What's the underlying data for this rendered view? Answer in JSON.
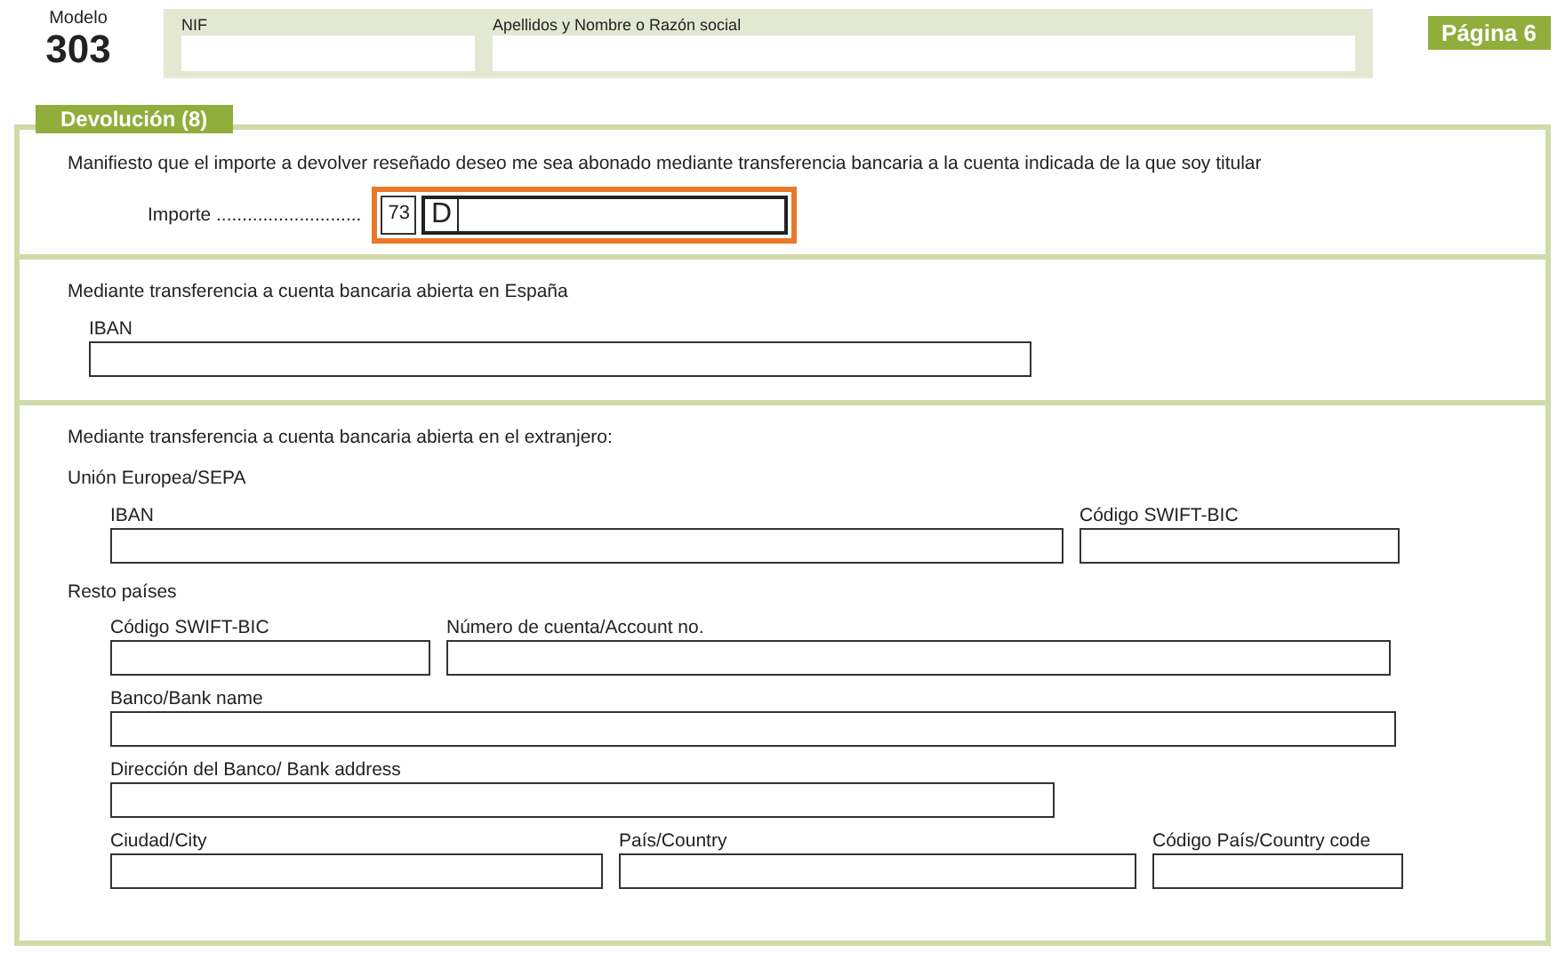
{
  "header": {
    "model_label": "Modelo",
    "model_number": "303",
    "fields": [
      {
        "label": "NIF"
      },
      {
        "label": "Apellidos y Nombre o Razón social"
      }
    ],
    "page_badge": "Página 6"
  },
  "section": {
    "title": "Devolución (8)",
    "statement": "Manifiesto que el importe a devolver reseñado deseo me sea abonado mediante transferencia bancaria a la cuenta indicada de la que soy titular",
    "amount": {
      "label": "Importe ............................",
      "box_number": "73",
      "sign": "D"
    },
    "spain": {
      "title": "Mediante transferencia a cuenta bancaria abierta en España",
      "fields": [
        {
          "label": "IBAN"
        }
      ]
    },
    "abroad": {
      "title": "Mediante transferencia a cuenta bancaria abierta en el extranjero:",
      "eu": {
        "title": "Unión Europea/SEPA",
        "fields": [
          {
            "label": "IBAN"
          },
          {
            "label": "Código SWIFT-BIC"
          }
        ]
      },
      "rest": {
        "title": "Resto países",
        "rows": [
          [
            {
              "label": "Código SWIFT-BIC"
            },
            {
              "label": "Número de cuenta/Account no."
            }
          ],
          [
            {
              "label": "Banco/Bank name"
            }
          ],
          [
            {
              "label": "Dirección del Banco/ Bank address"
            }
          ],
          [
            {
              "label": "Ciudad/City"
            },
            {
              "label": "País/Country"
            },
            {
              "label": "Código País/Country code"
            }
          ]
        ]
      }
    }
  }
}
